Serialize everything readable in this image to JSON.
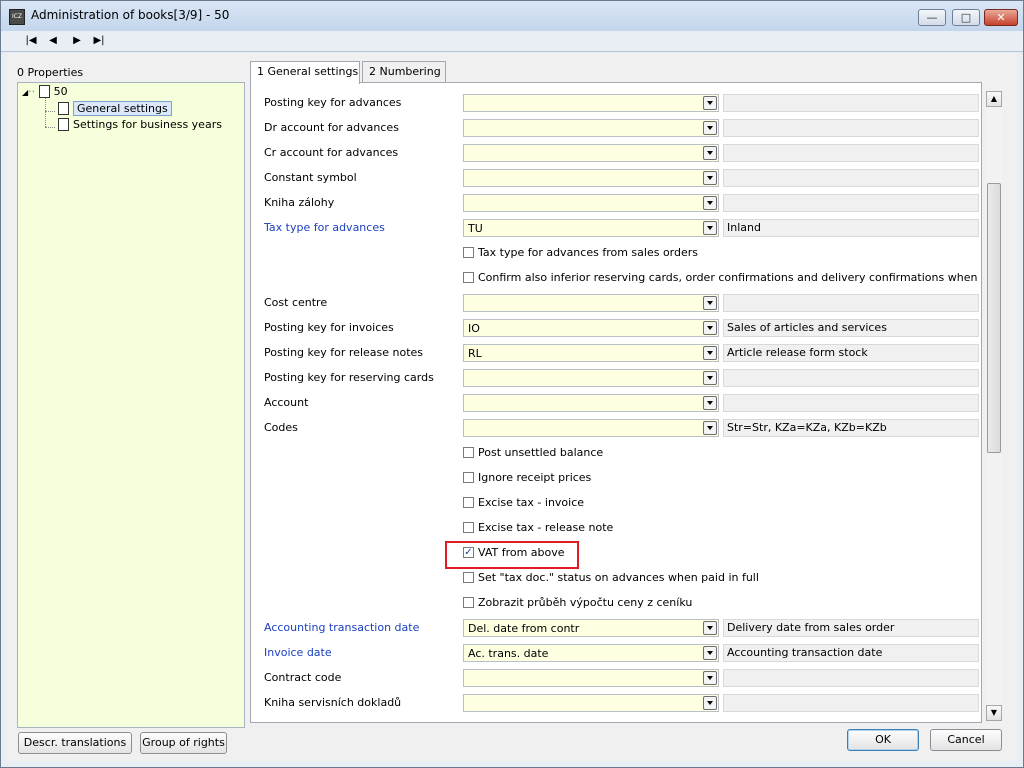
{
  "window": {
    "title": "Administration of books[3/9] - 50",
    "app_icon_text": "ICZ",
    "minimize": "—",
    "maximize": "□",
    "close": "✕"
  },
  "nav": {
    "first": "|◀",
    "prev": "◀",
    "next": "▶",
    "last": "▶|"
  },
  "properties": {
    "label": "0 Properties",
    "root": "50",
    "items": [
      "General settings",
      "Settings for business years"
    ]
  },
  "tabs": [
    "1 General settings",
    "2 Numbering"
  ],
  "rows": [
    {
      "label": "Posting key for advances",
      "value": "",
      "desc": ""
    },
    {
      "label": "Dr account for advances",
      "value": "",
      "desc": ""
    },
    {
      "label": "Cr account for advances",
      "value": "",
      "desc": ""
    },
    {
      "label": "Constant symbol",
      "value": "",
      "desc": ""
    },
    {
      "label": "Kniha zálohy",
      "value": "",
      "desc": ""
    },
    {
      "label": "Tax type for advances",
      "value": "TU",
      "desc": "Inland",
      "blue": true
    },
    {
      "check": "Tax type for advances from sales orders",
      "checked": false
    },
    {
      "check": "Confirm also inferior reserving cards, order confirmations and delivery confirmations when confirming sal",
      "checked": false
    },
    {
      "label": "Cost centre",
      "value": "",
      "desc": ""
    },
    {
      "label": "Posting key for invoices",
      "value": "IO",
      "desc": "Sales of articles and services"
    },
    {
      "label": "Posting key for release notes",
      "value": "RL",
      "desc": "Article release form stock"
    },
    {
      "label": "Posting key for reserving cards",
      "value": "",
      "desc": ""
    },
    {
      "label": "Account",
      "value": "",
      "desc": ""
    },
    {
      "label": "Codes",
      "value": "",
      "desc": "Str=Str, KZa=KZa, KZb=KZb"
    },
    {
      "check": "Post unsettled balance",
      "checked": false
    },
    {
      "check": "Ignore receipt prices",
      "checked": false
    },
    {
      "check": "Excise tax - invoice",
      "checked": false
    },
    {
      "check": "Excise tax - release note",
      "checked": false
    },
    {
      "check": "VAT from above",
      "checked": true
    },
    {
      "check": "Set \"tax doc.\" status on advances when paid in full",
      "checked": false
    },
    {
      "check": "Zobrazit průběh výpočtu ceny z ceníku",
      "checked": false
    },
    {
      "label": "Accounting transaction date",
      "value": "Del. date from contr",
      "desc": "Delivery date from sales order",
      "blue": true
    },
    {
      "label": "Invoice date",
      "value": "Ac. trans. date",
      "desc": "Accounting transaction date",
      "blue": true
    },
    {
      "label": "Contract code",
      "value": "",
      "desc": ""
    },
    {
      "label": "Kniha servisních dokladů",
      "value": "",
      "desc": ""
    }
  ],
  "buttons": {
    "descr_translations": "Descr. translations",
    "group_of_rights": "Group of rights",
    "ok": "OK",
    "cancel": "Cancel"
  },
  "colors": {
    "tree_bg": "#f5ffdb",
    "combo_bg": "#ffffe1",
    "link_label": "#1a3fbf",
    "highlight": "#e01b24"
  }
}
